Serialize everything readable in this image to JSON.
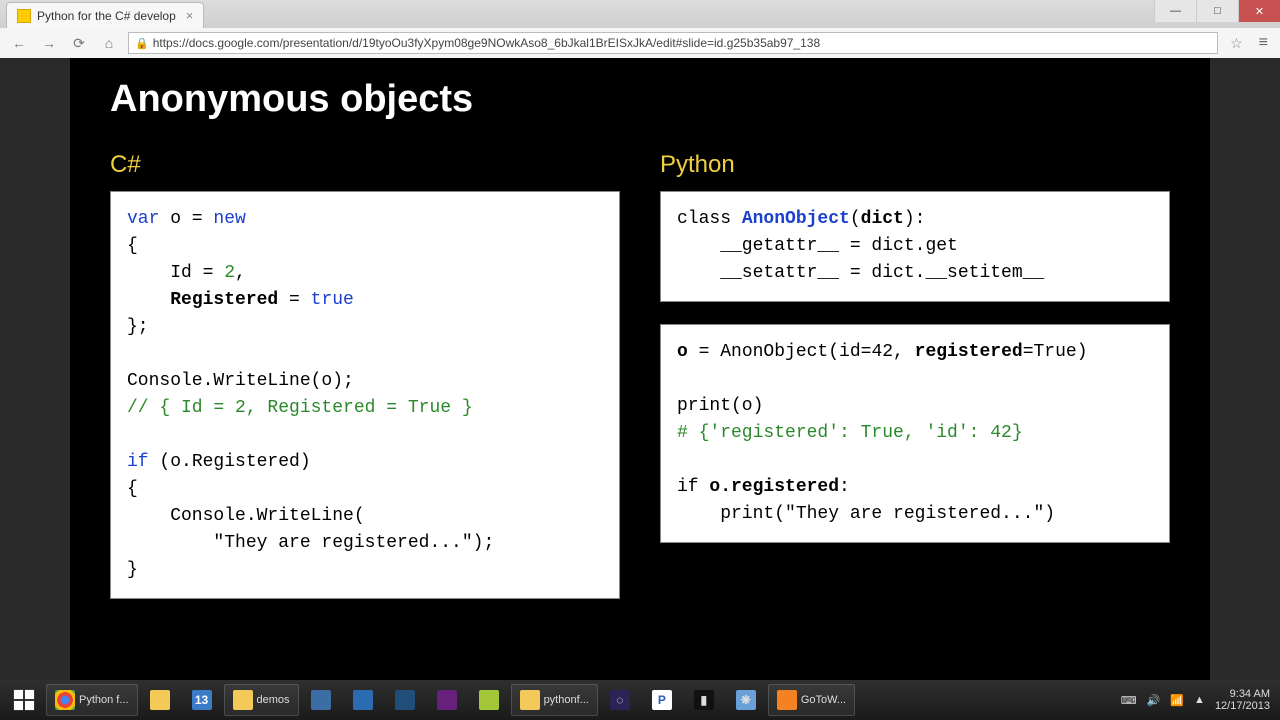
{
  "browser": {
    "tab_title": "Python for the C# develop",
    "url": "https://docs.google.com/presentation/d/19tyoOu3fyXpym08ge9NOwkAso8_6bJkal1BrEISxJkA/edit#slide=id.g25b35ab97_138"
  },
  "window_controls": {
    "minimize": "—",
    "maximize": "□",
    "close": "✕"
  },
  "nav": {
    "back": "←",
    "forward": "→",
    "reload": "⟳",
    "home": "⌂",
    "lock": "🔒",
    "star": "☆",
    "menu": "≡"
  },
  "side_tools": [
    "⎯",
    "●",
    "■",
    "■",
    "⏸",
    "⬤",
    "⚲",
    "✎",
    "✋"
  ],
  "slide": {
    "title": "Anonymous objects",
    "left_label": "C#",
    "right_label": "Python",
    "csharp": {
      "l1a": "var",
      "l1b": " o = ",
      "l1c": "new",
      "l2": "{",
      "l3a": "    Id = ",
      "l3b": "2",
      "l3c": ",",
      "l4a": "    ",
      "l4b": "Registered",
      "l4c": " = ",
      "l4d": "true",
      "l5": "};",
      "l6": "",
      "l7": "Console.WriteLine(o);",
      "l8": "// { Id = 2, Registered = True }",
      "l9": "",
      "l10a": "if",
      "l10b": " (o.Registered)",
      "l11": "{",
      "l12": "    Console.WriteLine(",
      "l13": "        \"They are registered...\");",
      "l14": "}"
    },
    "py1": {
      "l1a": "class ",
      "l1b": "AnonObject",
      "l1c": "(",
      "l1d": "dict",
      "l1e": "):",
      "l2": "    __getattr__ = dict.get",
      "l3": "    __setattr__ = dict.__setitem__"
    },
    "py2": {
      "l1a": "o",
      "l1b": " = AnonObject(id=42, ",
      "l1c": "registered",
      "l1d": "=True)",
      "l2": "",
      "l3": "print(o)",
      "l4": "# {'registered': True, 'id': 42}",
      "l5": "",
      "l6a": "if ",
      "l6b": "o.registered",
      "l6c": ":",
      "l7": "    print(\"They are registered...\")"
    }
  },
  "taskbar": {
    "items": [
      "Python f...",
      "",
      "13",
      "demos",
      "",
      "",
      "",
      "",
      "",
      "pythonf...",
      "",
      "P",
      "",
      "",
      "GoToW..."
    ],
    "tray": [
      "⌨",
      "🔊",
      "📶",
      "▲"
    ],
    "time": "9:34 AM",
    "date": "12/17/2013"
  }
}
